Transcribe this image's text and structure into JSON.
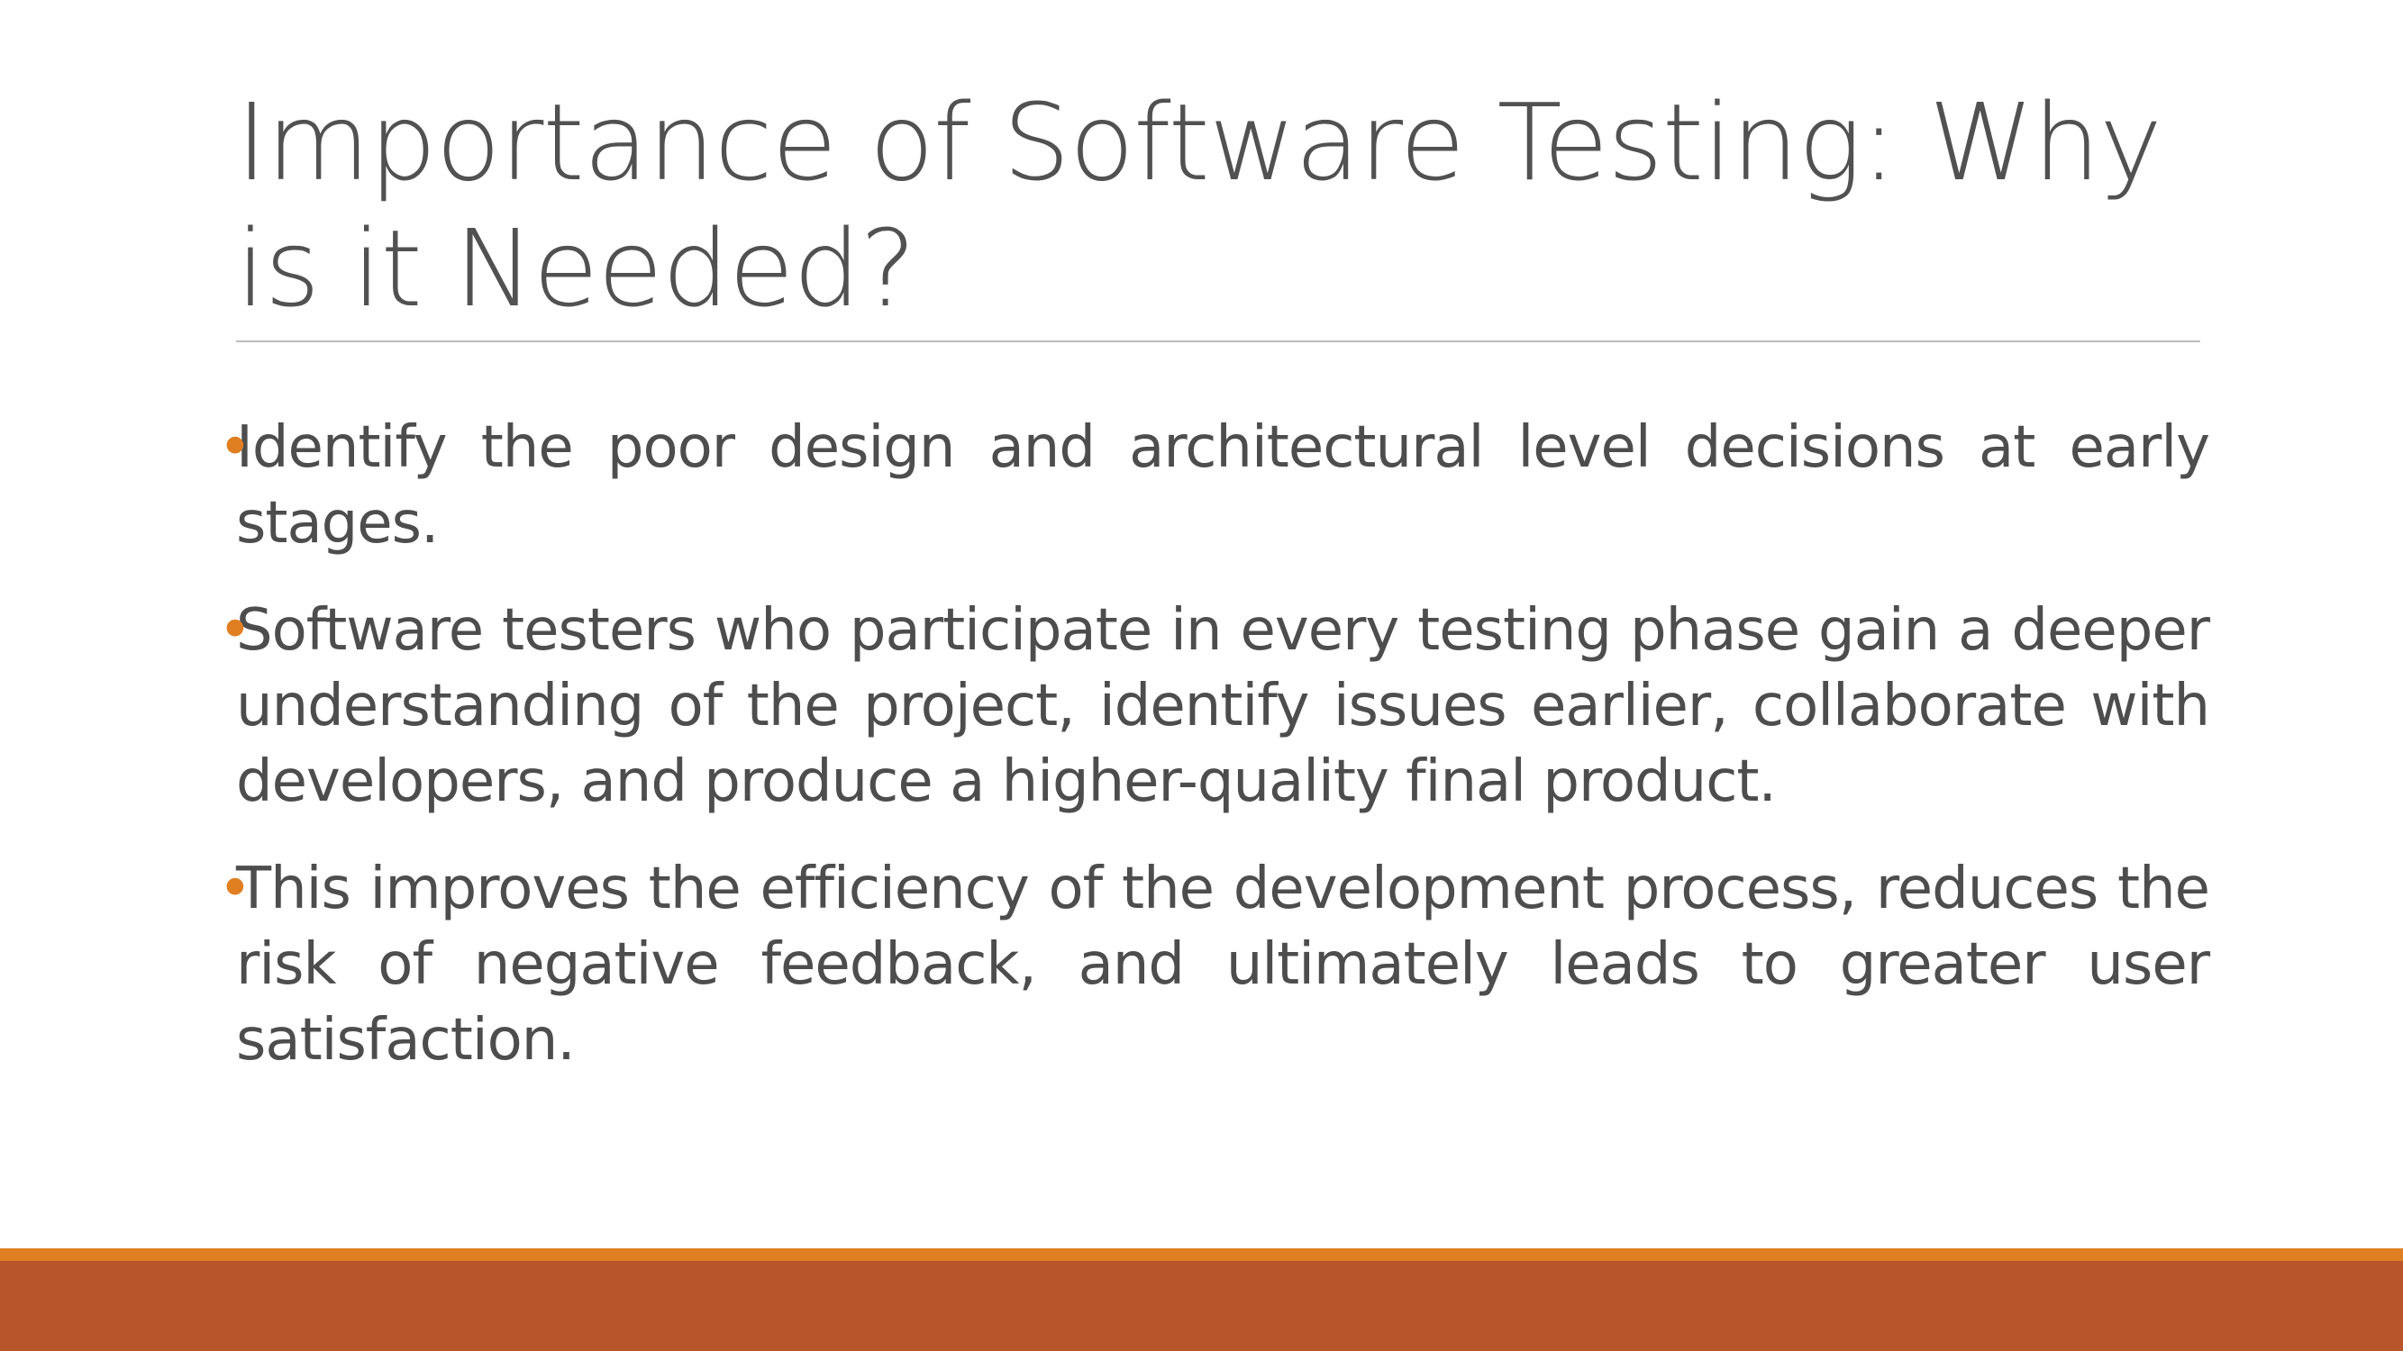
{
  "slide": {
    "title": "Importance of Software Testing: Why is it Needed?",
    "bullet_symbol": "•",
    "bullets": [
      "Identify the poor design and architectural level decisions at early stages.",
      "Software testers who participate in every testing phase gain a deeper understanding of the project, identify issues earlier, collaborate with developers, and produce a higher-quality final product.",
      "This improves the efficiency of the development process, reduces the risk of negative feedback, and ultimately leads to greater user satisfaction."
    ]
  },
  "colors": {
    "title_text": "#515151",
    "body_text": "#4d4d4d",
    "bullet_accent": "#e07f22",
    "footer_top_band": "#e07f22",
    "footer_band": "#b9552b",
    "title_rule": "#bdbdbd"
  }
}
